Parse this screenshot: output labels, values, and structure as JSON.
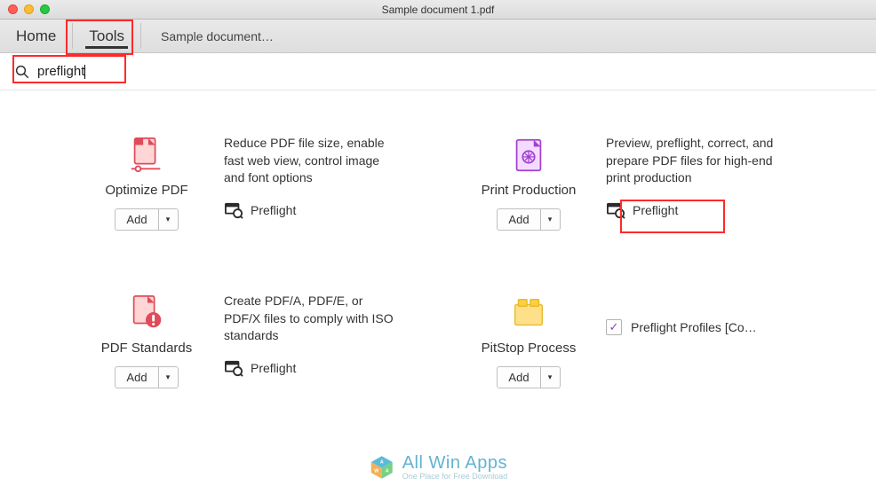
{
  "window": {
    "title": "Sample document 1.pdf"
  },
  "toolbar": {
    "home": "Home",
    "tools": "Tools",
    "document_tab": "Sample document…"
  },
  "search": {
    "value": "preflight"
  },
  "tools_grid": {
    "optimize_pdf": {
      "title": "Optimize PDF",
      "description": "Reduce PDF file size, enable fast web view, control image and font options",
      "preflight_label": "Preflight",
      "add_label": "Add"
    },
    "print_production": {
      "title": "Print Production",
      "description": "Preview, preflight, correct, and prepare PDF files for high-end print production",
      "preflight_label": "Preflight",
      "add_label": "Add"
    },
    "pdf_standards": {
      "title": "PDF Standards",
      "description": "Create PDF/A, PDF/E, or PDF/X files to comply with ISO standards",
      "preflight_label": "Preflight",
      "add_label": "Add"
    },
    "pitstop_process": {
      "title": "PitStop Process",
      "add_label": "Add"
    },
    "preflight_profiles": {
      "label": "Preflight Profiles [Co…"
    }
  },
  "watermark": {
    "text": "All Win Apps",
    "sub": "One Place for Free Download"
  },
  "caret": "▾",
  "check": "✓"
}
